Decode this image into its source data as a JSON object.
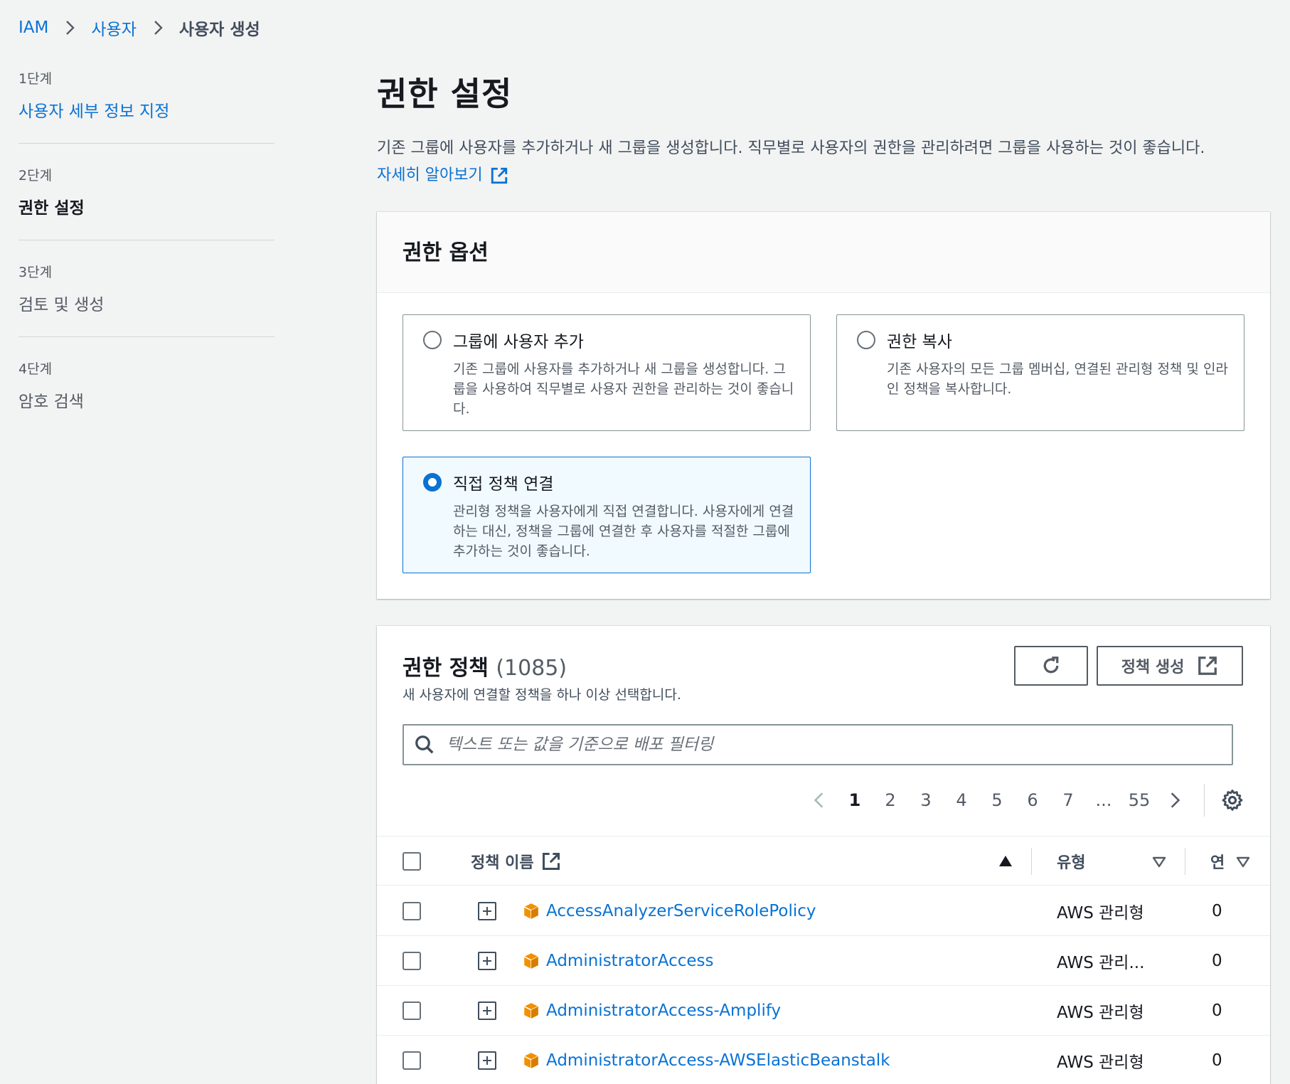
{
  "breadcrumb": {
    "root": "IAM",
    "parent": "사용자",
    "current": "사용자 생성"
  },
  "steps": [
    {
      "num": "1단계",
      "title": "사용자 세부 정보 지정"
    },
    {
      "num": "2단계",
      "title": "권한 설정"
    },
    {
      "num": "3단계",
      "title": "검토 및 생성"
    },
    {
      "num": "4단계",
      "title": "암호 검색"
    }
  ],
  "page": {
    "title": "권한 설정",
    "description": "기존 그룹에 사용자를 추가하거나 새 그룹을 생성합니다. 직무별로 사용자의 권한을 관리하려면 그룹을 사용하는 것이 좋습니다.",
    "learn_more": "자세히 알아보기"
  },
  "options": {
    "title": "권한 옵션",
    "items": [
      {
        "title": "그룹에 사용자 추가",
        "desc": "기존 그룹에 사용자를 추가하거나 새 그룹을 생성합니다. 그룹을 사용하여 직무별로 사용자 권한을 관리하는 것이 좋습니다.",
        "selected": false
      },
      {
        "title": "권한 복사",
        "desc": "기존 사용자의 모든 그룹 멤버십, 연결된 관리형 정책 및 인라인 정책을 복사합니다.",
        "selected": false
      },
      {
        "title": "직접 정책 연결",
        "desc": "관리형 정책을 사용자에게 직접 연결합니다. 사용자에게 연결하는 대신, 정책을 그룹에 연결한 후 사용자를 적절한 그룹에 추가하는 것이 좋습니다.",
        "selected": true
      }
    ]
  },
  "policies": {
    "title": "권한 정책",
    "count": "(1085)",
    "subtitle": "새 사용자에 연결할 정책을 하나 이상 선택합니다.",
    "create_label": "정책 생성",
    "search_placeholder": "텍스트 또는 값을 기준으로 배포 필터링",
    "pages": [
      "1",
      "2",
      "3",
      "4",
      "5",
      "6",
      "7",
      "...",
      "55"
    ],
    "active_page": "1",
    "columns": {
      "name": "정책 이름",
      "type": "유형",
      "attached": "연"
    },
    "rows": [
      {
        "name": "AccessAnalyzerServiceRolePolicy",
        "type": "AWS 관리형",
        "attached": "0"
      },
      {
        "name": "AdministratorAccess",
        "type": "AWS 관리...",
        "attached": "0"
      },
      {
        "name": "AdministratorAccess-Amplify",
        "type": "AWS 관리형",
        "attached": "0"
      },
      {
        "name": "AdministratorAccess-AWSElasticBeanstalk",
        "type": "AWS 관리형",
        "attached": "0"
      }
    ]
  },
  "colors": {
    "link": "#0972d3",
    "selected_bg": "#f1faff",
    "cube": "#f29100"
  }
}
